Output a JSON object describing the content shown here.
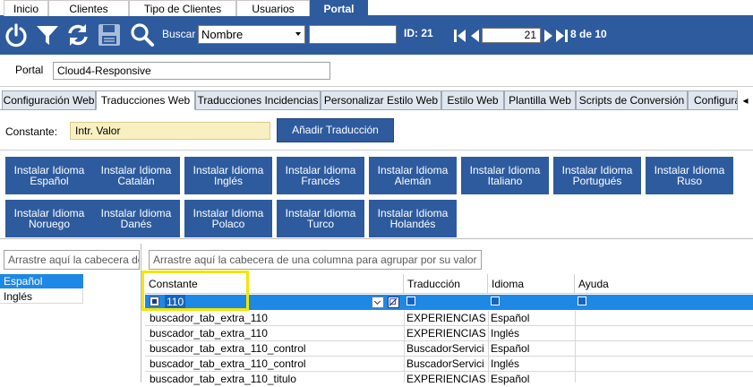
{
  "topnav": {
    "tabs": [
      "Inicio",
      "Clientes",
      "Tipo de Clientes",
      "Usuarios",
      "Portal"
    ],
    "active": "Portal"
  },
  "toolbar": {
    "icons": [
      "power-icon",
      "filter-icon",
      "refresh-icon",
      "save-icon",
      "search-icon"
    ],
    "search_label": "Buscar",
    "search_field_select": "Nombre",
    "search_value": "",
    "id_label": "ID: 21",
    "pager_value": "21",
    "pager_text": "8 de 10"
  },
  "portal": {
    "label": "Portal",
    "value": "Cloud4-Responsive"
  },
  "subtabs": {
    "items": [
      "Configuración Web",
      "Traducciones Web",
      "Traducciones Incidencias",
      "Personalizar Estilo Web",
      "Estilo Web",
      "Plantilla Web",
      "Scripts de Conversión",
      "Configura"
    ],
    "active": "Traducciones Web",
    "scroll_arrow": "◂"
  },
  "constante": {
    "label": "Constante:",
    "value": "Intr. Valor",
    "button": "Añadir Traducción"
  },
  "languages": [
    {
      "line1": "Instalar Idioma",
      "line2": "Español"
    },
    {
      "line1": "Instalar Idioma",
      "line2": "Catalán"
    },
    {
      "line1": "Instalar Idioma",
      "line2": "Inglés"
    },
    {
      "line1": "Instalar Idioma",
      "line2": "Francés"
    },
    {
      "line1": "Instalar Idioma",
      "line2": "Alemán"
    },
    {
      "line1": "Instalar Idioma",
      "line2": "Italiano"
    },
    {
      "line1": "Instalar Idioma",
      "line2": "Portugués"
    },
    {
      "line1": "Instalar Idioma",
      "line2": "Ruso"
    },
    {
      "line1": "Instalar Idioma",
      "line2": "Noruego"
    },
    {
      "line1": "Instalar Idioma",
      "line2": "Danés"
    },
    {
      "line1": "Instalar Idioma",
      "line2": "Polaco"
    },
    {
      "line1": "Instalar Idioma",
      "line2": "Turco"
    },
    {
      "line1": "Instalar Idioma",
      "line2": "Holandés"
    }
  ],
  "left_panel": {
    "group_hint": "Arrastre aquí la cabecera de",
    "items": [
      "Español",
      "Inglés"
    ],
    "selected": "Español"
  },
  "grid": {
    "group_hint": "Arrastre aquí la cabecera de una columna para agrupar por su valor",
    "columns": [
      "Constante",
      "Traducción",
      "Idioma",
      "Ayuda"
    ],
    "filter_value": "110",
    "rows": [
      [
        "buscador_tab_extra_110",
        "EXPERIENCIAS",
        "Español",
        ""
      ],
      [
        "buscador_tab_extra_110",
        "EXPERIENCIAS",
        "Inglés",
        ""
      ],
      [
        "buscador_tab_extra_110_control",
        "BuscadorServici...",
        "Español",
        ""
      ],
      [
        "buscador_tab_extra_110_control",
        "BuscadorServici...",
        "Inglés",
        ""
      ],
      [
        "buscador_tab_extra_110_titulo",
        "EXPERIENCIAS",
        "Español",
        ""
      ]
    ]
  },
  "colors": {
    "brand": "#2e5b9e",
    "highlight": "#f2e600",
    "selection": "#1e88e5",
    "input_yellow": "#f8f0c0"
  }
}
